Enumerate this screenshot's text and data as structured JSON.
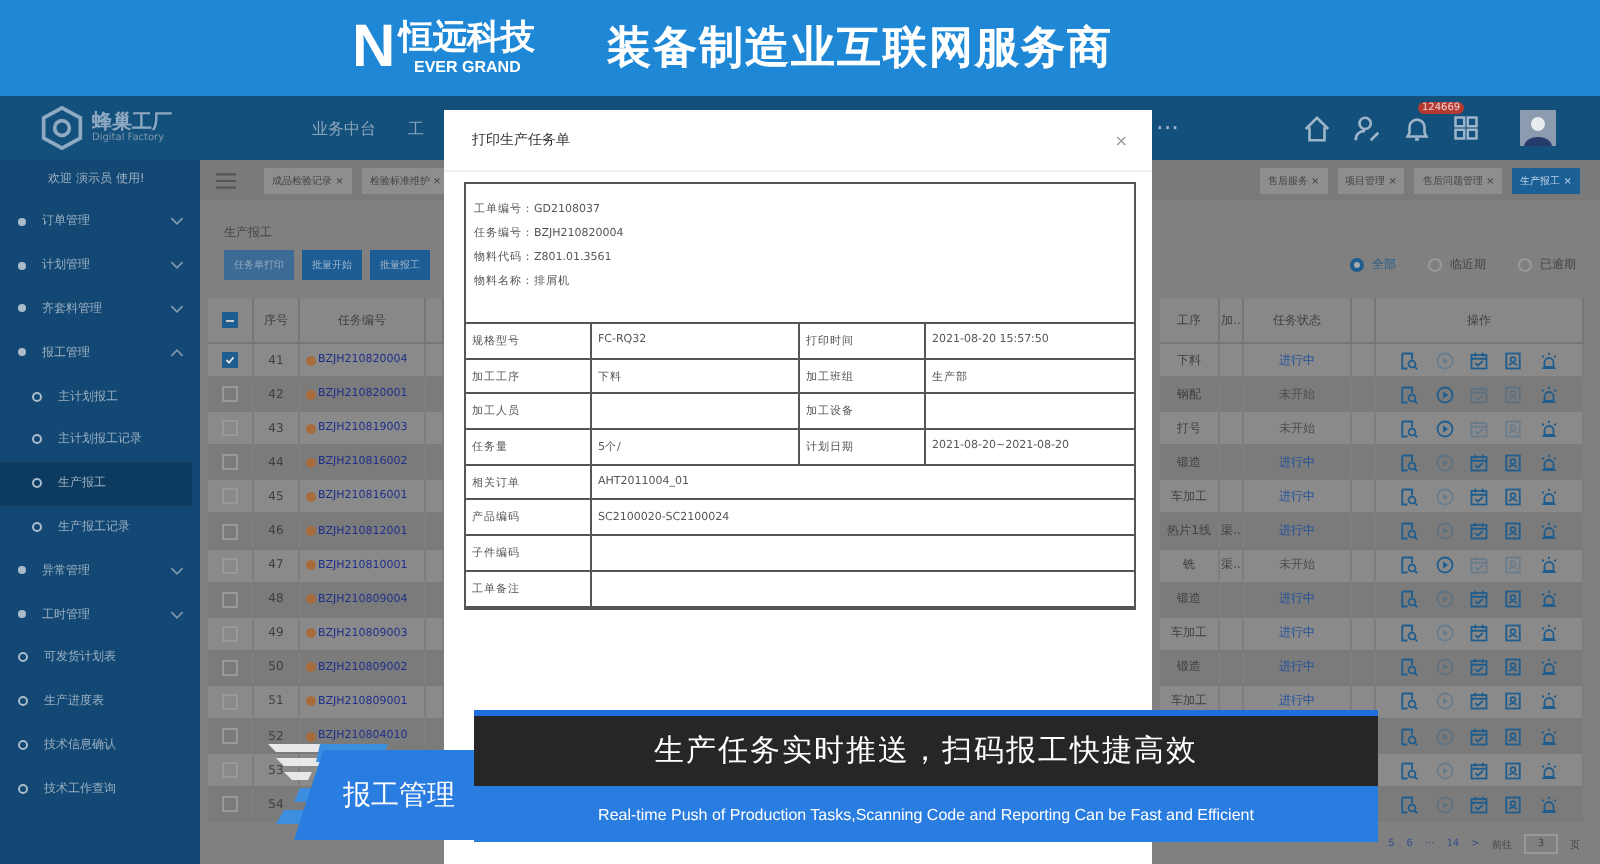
{
  "banner": {
    "mark": "N",
    "brand": "恒远科技",
    "brand_en": "EVER GRAND",
    "slogan": "装备制造业互联网服务商"
  },
  "header": {
    "app_name": "蜂巢工厂",
    "app_name_en": "Digital Factory",
    "nav": [
      "业务中台",
      "工"
    ],
    "more": "···",
    "badge": "124669"
  },
  "sidebar": {
    "welcome": "欢迎 演示员 使用!",
    "items": [
      {
        "kind": "group",
        "label": "订单管理",
        "expanded": false
      },
      {
        "kind": "group",
        "label": "计划管理",
        "expanded": false
      },
      {
        "kind": "group",
        "label": "齐套料管理",
        "expanded": false
      },
      {
        "kind": "group",
        "label": "报工管理",
        "expanded": true,
        "children": [
          {
            "label": "主计划报工",
            "selected": false
          },
          {
            "label": "主计划报工记录",
            "selected": false
          },
          {
            "label": "生产报工",
            "selected": true
          },
          {
            "label": "生产报工记录",
            "selected": false
          }
        ]
      },
      {
        "kind": "group",
        "label": "异常管理",
        "expanded": false
      },
      {
        "kind": "group",
        "label": "工时管理",
        "expanded": false
      },
      {
        "kind": "link",
        "label": "可发货计划表",
        "selected": false
      },
      {
        "kind": "link",
        "label": "生产进度表",
        "selected": false
      },
      {
        "kind": "link",
        "label": "技术信息确认",
        "selected": false
      },
      {
        "kind": "link",
        "label": "技术工作查询",
        "selected": false
      }
    ]
  },
  "tabs_left": [
    {
      "label": "成品检验记录",
      "close": "×",
      "selected": false
    },
    {
      "label": "检验标准维护",
      "close": "×",
      "selected": false
    }
  ],
  "tabs_right": [
    {
      "label": "售后服务",
      "close": "×",
      "selected": false
    },
    {
      "label": "项目管理",
      "close": "×",
      "selected": false
    },
    {
      "label": "售后问题管理",
      "close": "×",
      "selected": false
    },
    {
      "label": "生产报工",
      "close": "×",
      "selected": true
    }
  ],
  "breadcrumb": "生产报工",
  "buttons": [
    {
      "label": "任务单打印",
      "disabled": true
    },
    {
      "label": "批量开始",
      "disabled": false
    },
    {
      "label": "批量报工",
      "disabled": false
    }
  ],
  "filters": [
    {
      "label": "全部",
      "selected": true
    },
    {
      "label": "临近期",
      "selected": false
    },
    {
      "label": "已逾期",
      "selected": false
    }
  ],
  "table": {
    "indeterminate": true,
    "columns_left": [
      "序号",
      "任务编号"
    ],
    "columns_right": [
      "工序",
      "加..",
      "任务状态",
      "操作"
    ],
    "rows": [
      {
        "seq": "41",
        "task_no": "BZJH210820004",
        "process": "下料",
        "status": "进行中",
        "active": true,
        "checked": true
      },
      {
        "seq": "42",
        "task_no": "BZJH210820001",
        "process": "钢配",
        "status": "未开始",
        "active": false,
        "checked": false
      },
      {
        "seq": "43",
        "task_no": "BZJH210819003",
        "process": "打号",
        "status": "未开始",
        "active": false,
        "checked": false
      },
      {
        "seq": "44",
        "task_no": "BZJH210816002",
        "process": "锻造",
        "status": "进行中",
        "active": true,
        "checked": false
      },
      {
        "seq": "45",
        "task_no": "BZJH210816001",
        "process": "车加工",
        "status": "进行中",
        "active": true,
        "checked": false
      },
      {
        "seq": "46",
        "task_no": "BZJH210812001",
        "process": "热片1线",
        "extra": "渠..",
        "status": "进行中",
        "active": true,
        "checked": false
      },
      {
        "seq": "47",
        "task_no": "BZJH210810001",
        "process": "铣",
        "extra": "渠..",
        "status": "未开始",
        "active": false,
        "checked": false
      },
      {
        "seq": "48",
        "task_no": "BZJH210809004",
        "process": "锻造",
        "status": "进行中",
        "active": true,
        "checked": false
      },
      {
        "seq": "49",
        "task_no": "BZJH210809003",
        "process": "车加工",
        "status": "进行中",
        "active": true,
        "checked": false
      },
      {
        "seq": "50",
        "task_no": "BZJH210809002",
        "process": "锻造",
        "status": "进行中",
        "active": true,
        "checked": false
      },
      {
        "seq": "51",
        "task_no": "BZJH210809001",
        "process": "车加工",
        "status": "进行中",
        "active": true,
        "checked": false
      },
      {
        "seq": "52",
        "task_no": "BZJH210804010",
        "active": true,
        "checked": false
      },
      {
        "seq": "53",
        "active": true,
        "checked": false
      },
      {
        "seq": "54",
        "active": true,
        "checked": false
      }
    ]
  },
  "pagination": {
    "pages": [
      "5",
      "6",
      "···",
      "14"
    ],
    "next": ">",
    "goto": "前往",
    "page": "3",
    "unit": "页"
  },
  "modal": {
    "title": "打印生产任务单",
    "close": "×",
    "info": [
      "工单编号：GD2108037",
      "任务编号：BZJH210820004",
      "物料代码：Z801.01.3561",
      "物料名称：排屑机"
    ],
    "rows": [
      {
        "cells": [
          "规格型号",
          "FC-RQ32",
          "打印时间",
          "2021-08-20 15:57:50"
        ]
      },
      {
        "cells": [
          "加工工序",
          "下料",
          "加工班组",
          "生产部"
        ]
      },
      {
        "cells": [
          "加工人员",
          "",
          "加工设备",
          ""
        ]
      },
      {
        "cells": [
          "任务量",
          "5个/",
          "计划日期",
          "2021-08-20~2021-08-20"
        ]
      },
      {
        "cells": [
          "相关订单",
          "AHT2011004_01"
        ]
      },
      {
        "cells": [
          "产品编码",
          "SC2100020-SC2100024"
        ]
      },
      {
        "cells": [
          "子件编码",
          ""
        ]
      },
      {
        "cells": [
          "工单备注",
          ""
        ]
      }
    ]
  },
  "caption": {
    "badge": "报工管理",
    "headline": "生产任务实时推送，扫码报工快捷高效",
    "subtitle": "Real-time Push of Production Tasks,Scanning Code and Reporting Can be Fast and Efficient"
  }
}
